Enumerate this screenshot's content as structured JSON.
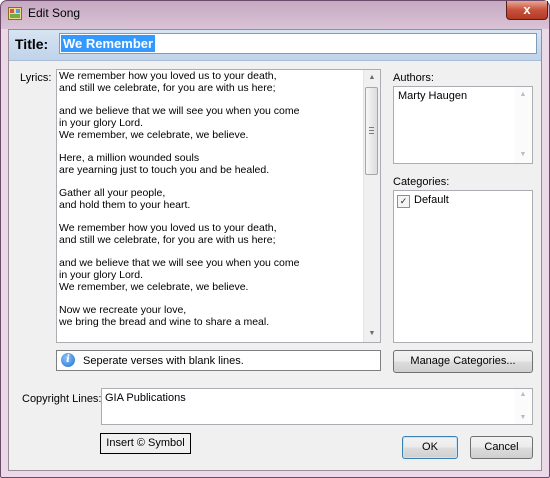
{
  "window": {
    "title": "Edit Song",
    "close_glyph": "x",
    "app_icon": "app-icon"
  },
  "title_field": {
    "label": "Title:",
    "value": "We Remember"
  },
  "lyrics": {
    "label": "Lyrics:",
    "paragraphs": [
      [
        "We remember how you loved us to your death,",
        "and still we celebrate, for you are with us here;"
      ],
      [
        "and we believe that we will see you when you come",
        "in your glory Lord.",
        "We remember, we celebrate, we believe."
      ],
      [
        "Here, a million wounded souls",
        "are yearning just to touch you and be healed."
      ],
      [
        "Gather all your people,",
        "and hold them to your heart."
      ],
      [
        "We remember how you loved us to your death,",
        "and still we celebrate, for you are with us here;"
      ],
      [
        "and we believe that we will see you when you come",
        "in your glory Lord.",
        "We remember, we celebrate, we believe."
      ],
      [
        "Now we recreate your love,",
        "we bring the bread and wine to share a meal."
      ]
    ]
  },
  "hint": {
    "text": "Seperate verses with blank lines.",
    "icon": "info-icon"
  },
  "authors": {
    "label": "Authors:",
    "items": [
      "Marty Haugen"
    ]
  },
  "categories": {
    "label": "Categories:",
    "items": [
      {
        "label": "Default",
        "checked": true
      }
    ]
  },
  "manage_categories_label": "Manage Categories...",
  "copyright": {
    "label": "Copyright Lines:",
    "value": "GIA Publications"
  },
  "insert_symbol_label": "Insert © Symbol",
  "ok_label": "OK",
  "cancel_label": "Cancel",
  "colors": {
    "selection": "#3399ff",
    "title_strip": "#bfd3ea",
    "window_frame": "#c6a9c2"
  }
}
